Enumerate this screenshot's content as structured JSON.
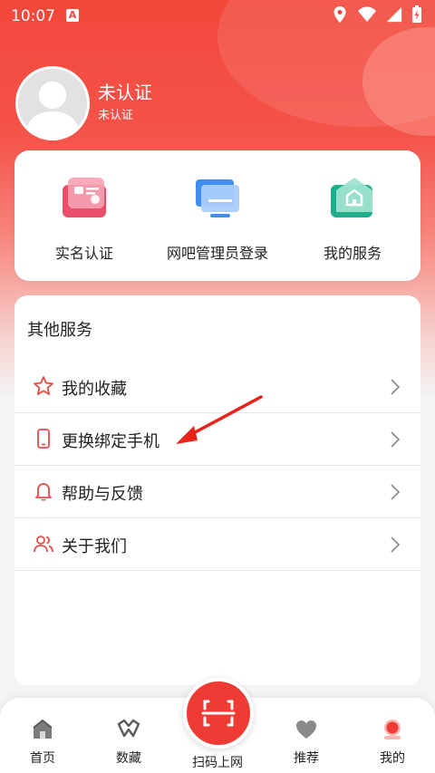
{
  "status": {
    "time": "10:07",
    "notif_letter": "A"
  },
  "profile": {
    "name": "未认证",
    "subtitle": "未认证"
  },
  "quick_actions": [
    {
      "label": "实名认证",
      "icon": "id-card-icon"
    },
    {
      "label": "网吧管理员登录",
      "icon": "monitor-icon"
    },
    {
      "label": "我的服务",
      "icon": "home-service-icon"
    }
  ],
  "services": {
    "title": "其他服务",
    "items": [
      {
        "label": "我的收藏",
        "icon": "star-icon"
      },
      {
        "label": "更换绑定手机",
        "icon": "phone-icon"
      },
      {
        "label": "帮助与反馈",
        "icon": "bell-icon"
      },
      {
        "label": "关于我们",
        "icon": "users-icon"
      }
    ]
  },
  "nav": {
    "items": [
      {
        "label": "首页",
        "icon": "home-icon"
      },
      {
        "label": "数藏",
        "icon": "collection-icon"
      },
      {
        "label": "推荐",
        "icon": "heart-icon"
      },
      {
        "label": "我的",
        "icon": "profile-icon"
      }
    ],
    "scan_label": "扫码上网"
  },
  "colors": {
    "accent": "#f2473b",
    "text": "#222222"
  }
}
